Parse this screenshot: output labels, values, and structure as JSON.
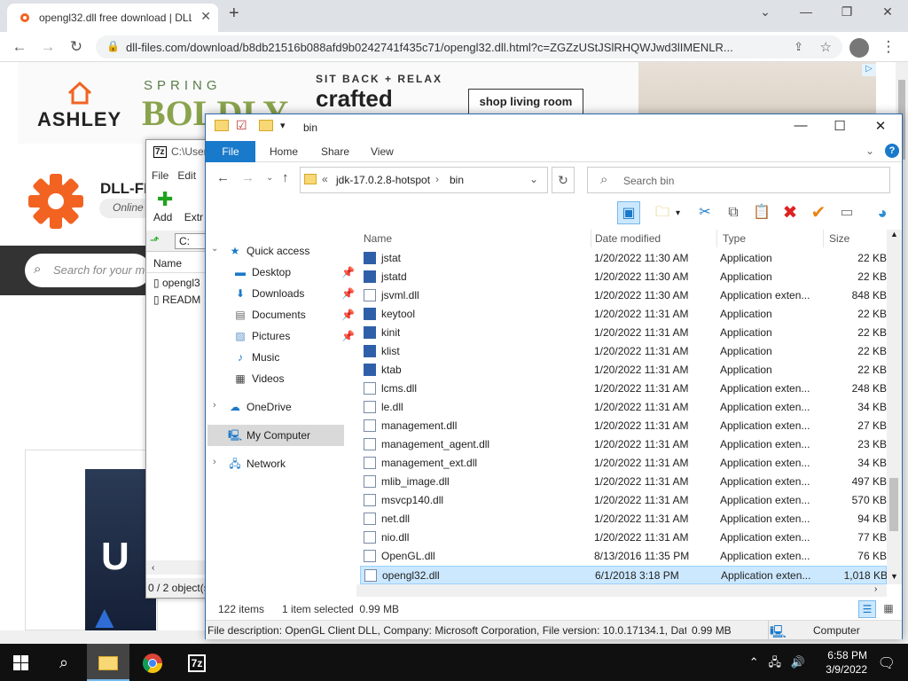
{
  "chrome": {
    "tab_title": "opengl32.dll free download | DLL",
    "url": "dll-files.com/download/b8db21516b088afd9b0242741f435c71/opengl32.dll.html?c=ZGZzUStJSlRHQWJwd3lIMENLR..."
  },
  "ad": {
    "brand": "ASHLEY",
    "spring": "SPRING",
    "boldly": "BOLDLY",
    "sit_back": "SIT BACK + RELAX",
    "crafted": "crafted",
    "cta": "shop living room"
  },
  "site": {
    "name": "DLL-FI",
    "tag": "Online",
    "search_placeholder": "Search for your m"
  },
  "sevenzip": {
    "title": "C:\\User",
    "menu": [
      "File",
      "Edit"
    ],
    "add_label": "Add",
    "extract_label": "Extr",
    "path": "C:",
    "col_name": "Name",
    "files": [
      "opengl3",
      "READM"
    ],
    "status": "0 / 2 object(s"
  },
  "explorer": {
    "title": "bin",
    "tabs": [
      "File",
      "Home",
      "Share",
      "View"
    ],
    "breadcrumb": [
      "jdk-17.0.2.8-hotspot",
      "bin"
    ],
    "search_placeholder": "Search bin",
    "nav": [
      {
        "label": "Quick access",
        "icon": "star-icon"
      },
      {
        "label": "Desktop",
        "icon": "desktop-icon",
        "pinned": true
      },
      {
        "label": "Downloads",
        "icon": "download-icon",
        "pinned": true
      },
      {
        "label": "Documents",
        "icon": "document-icon",
        "pinned": true
      },
      {
        "label": "Pictures",
        "icon": "picture-icon",
        "pinned": true
      },
      {
        "label": "Music",
        "icon": "music-icon"
      },
      {
        "label": "Videos",
        "icon": "video-icon"
      },
      {
        "label": "OneDrive",
        "icon": "cloud-icon"
      },
      {
        "label": "My Computer",
        "icon": "computer-icon",
        "selected": true
      },
      {
        "label": "Network",
        "icon": "network-icon"
      }
    ],
    "columns": [
      "Name",
      "Date modified",
      "Type",
      "Size"
    ],
    "files": [
      {
        "name": "jstat",
        "date": "1/20/2022 11:30 AM",
        "type": "Application",
        "size": "22 KB",
        "kind": "app"
      },
      {
        "name": "jstatd",
        "date": "1/20/2022 11:30 AM",
        "type": "Application",
        "size": "22 KB",
        "kind": "app"
      },
      {
        "name": "jsvml.dll",
        "date": "1/20/2022 11:30 AM",
        "type": "Application exten...",
        "size": "848 KB",
        "kind": "dll"
      },
      {
        "name": "keytool",
        "date": "1/20/2022 11:31 AM",
        "type": "Application",
        "size": "22 KB",
        "kind": "app"
      },
      {
        "name": "kinit",
        "date": "1/20/2022 11:31 AM",
        "type": "Application",
        "size": "22 KB",
        "kind": "app"
      },
      {
        "name": "klist",
        "date": "1/20/2022 11:31 AM",
        "type": "Application",
        "size": "22 KB",
        "kind": "app"
      },
      {
        "name": "ktab",
        "date": "1/20/2022 11:31 AM",
        "type": "Application",
        "size": "22 KB",
        "kind": "app"
      },
      {
        "name": "lcms.dll",
        "date": "1/20/2022 11:31 AM",
        "type": "Application exten...",
        "size": "248 KB",
        "kind": "dll"
      },
      {
        "name": "le.dll",
        "date": "1/20/2022 11:31 AM",
        "type": "Application exten...",
        "size": "34 KB",
        "kind": "dll"
      },
      {
        "name": "management.dll",
        "date": "1/20/2022 11:31 AM",
        "type": "Application exten...",
        "size": "27 KB",
        "kind": "dll"
      },
      {
        "name": "management_agent.dll",
        "date": "1/20/2022 11:31 AM",
        "type": "Application exten...",
        "size": "23 KB",
        "kind": "dll"
      },
      {
        "name": "management_ext.dll",
        "date": "1/20/2022 11:31 AM",
        "type": "Application exten...",
        "size": "34 KB",
        "kind": "dll"
      },
      {
        "name": "mlib_image.dll",
        "date": "1/20/2022 11:31 AM",
        "type": "Application exten...",
        "size": "497 KB",
        "kind": "dll"
      },
      {
        "name": "msvcp140.dll",
        "date": "1/20/2022 11:31 AM",
        "type": "Application exten...",
        "size": "570 KB",
        "kind": "dll"
      },
      {
        "name": "net.dll",
        "date": "1/20/2022 11:31 AM",
        "type": "Application exten...",
        "size": "94 KB",
        "kind": "dll"
      },
      {
        "name": "nio.dll",
        "date": "1/20/2022 11:31 AM",
        "type": "Application exten...",
        "size": "77 KB",
        "kind": "dll"
      },
      {
        "name": "OpenGL.dll",
        "date": "8/13/2016 11:35 PM",
        "type": "Application exten...",
        "size": "76 KB",
        "kind": "dll"
      },
      {
        "name": "opengl32.dll",
        "date": "6/1/2018 3:18 PM",
        "type": "Application exten...",
        "size": "1,018 KB",
        "kind": "dll",
        "selected": true
      }
    ],
    "status_items": "122 items",
    "status_selected": "1 item selected  0.99 MB",
    "details_desc": "File description: OpenGL Client DLL, Company: Microsoft Corporation, File version: 10.0.17134.1, Date c",
    "details_size": "0.99 MB",
    "details_location": "Computer"
  },
  "taskbar": {
    "time": "6:58 PM",
    "date": "3/9/2022",
    "sevenzip_label": "7z"
  },
  "colors": {
    "accent": "#1979ca",
    "selection": "#cce8ff",
    "taskbar": "#101010"
  }
}
